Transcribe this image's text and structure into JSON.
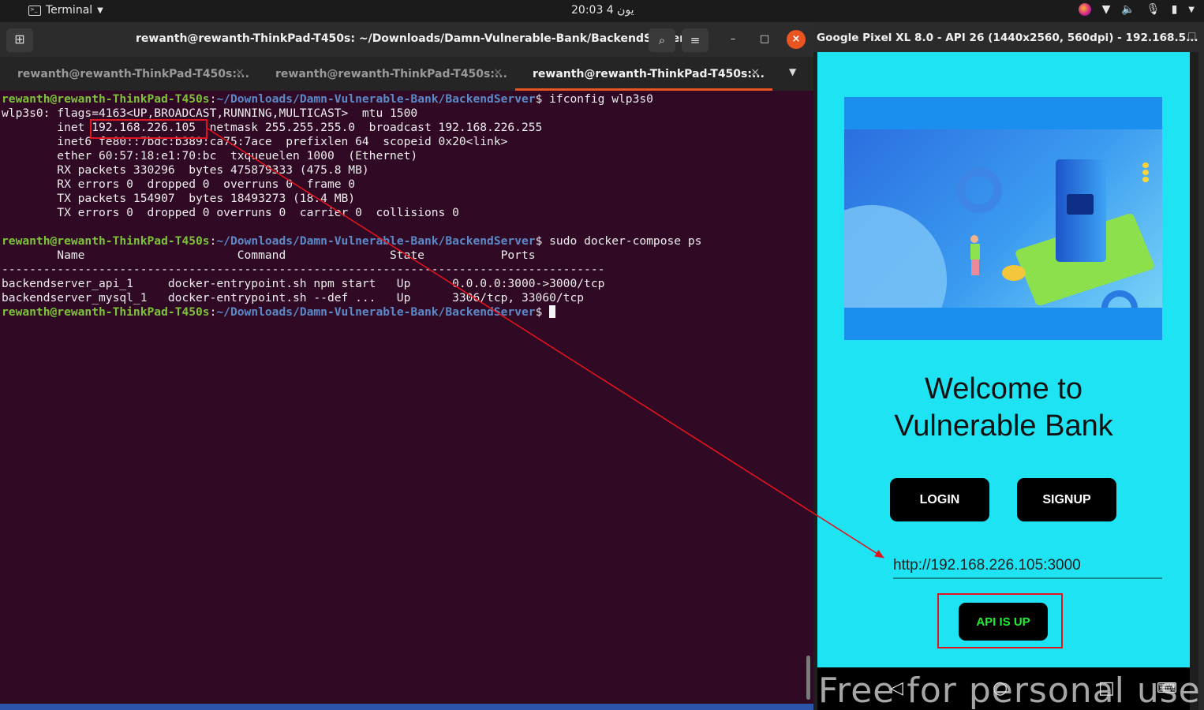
{
  "topbar": {
    "app_name": "Terminal",
    "clock": "20:03  4 يون"
  },
  "terminal": {
    "window_title": "rewanth@rewanth-ThinkPad-T450s: ~/Downloads/Damn-Vulnerable-Bank/BackendServer",
    "tabs": [
      {
        "label": "rewanth@rewanth-ThinkPad-T450s:..."
      },
      {
        "label": "rewanth@rewanth-ThinkPad-T450s:..."
      },
      {
        "label": "rewanth@rewanth-ThinkPad-T450s:..."
      }
    ],
    "prompt_user": "rewanth@rewanth-ThinkPad-T450s",
    "prompt_path": "~/Downloads/Damn-Vulnerable-Bank/BackendServer",
    "cmd1": "$ ifconfig wlp3s0",
    "cmd2": "$ sudo docker-compose ps",
    "cmd3": "$ ",
    "out_lines": [
      "wlp3s0: flags=4163<UP,BROADCAST,RUNNING,MULTICAST>  mtu 1500",
      "        inet 192.168.226.105  netmask 255.255.255.0  broadcast 192.168.226.255",
      "        inet6 fe80::7bdc:b389:ca75:7ace  prefixlen 64  scopeid 0x20<link>",
      "        ether 60:57:18:e1:70:bc  txqueuelen 1000  (Ethernet)",
      "        RX packets 330296  bytes 475879333 (475.8 MB)",
      "        RX errors 0  dropped 0  overruns 0  frame 0",
      "        TX packets 154907  bytes 18493273 (18.4 MB)",
      "        TX errors 0  dropped 0 overruns 0  carrier 0  collisions 0"
    ],
    "ps_header": "        Name                      Command               State           Ports",
    "ps_rule": "---------------------------------------------------------------------------------------",
    "ps_rows": [
      "backendserver_api_1     docker-entrypoint.sh npm start   Up      0.0.0.0:3000->3000/tcp",
      "backendserver_mysql_1   docker-entrypoint.sh --def ...   Up      3306/tcp, 33060/tcp"
    ]
  },
  "emulator": {
    "window_title": "Google Pixel XL 8.0 - API 26 (1440x2560, 560dpi) - 192.168.5...",
    "welcome_line1": "Welcome to",
    "welcome_line2": "Vulnerable Bank",
    "login_label": "LOGIN",
    "signup_label": "SIGNUP",
    "api_url": "http://192.168.226.105:3000",
    "api_status_label": "API IS UP",
    "watermark": "Free for personal use"
  },
  "colors": {
    "terminal_bg": "#300a24",
    "prompt_user": "#7ec23a",
    "prompt_path": "#5c89c7",
    "app_bg": "#1ee3f3",
    "api_status_text": "#1ef032",
    "annotation": "#e0141e",
    "accent": "#e95420"
  },
  "icons": {
    "new_tab": "new-tab-icon",
    "search": "search-icon",
    "menu": "hamburger-icon",
    "minimize": "minimize-icon",
    "maximize": "maximize-icon",
    "close": "close-icon",
    "back": "back-icon",
    "home": "home-icon",
    "recents": "recents-icon",
    "keyboard": "keyboard-icon"
  }
}
